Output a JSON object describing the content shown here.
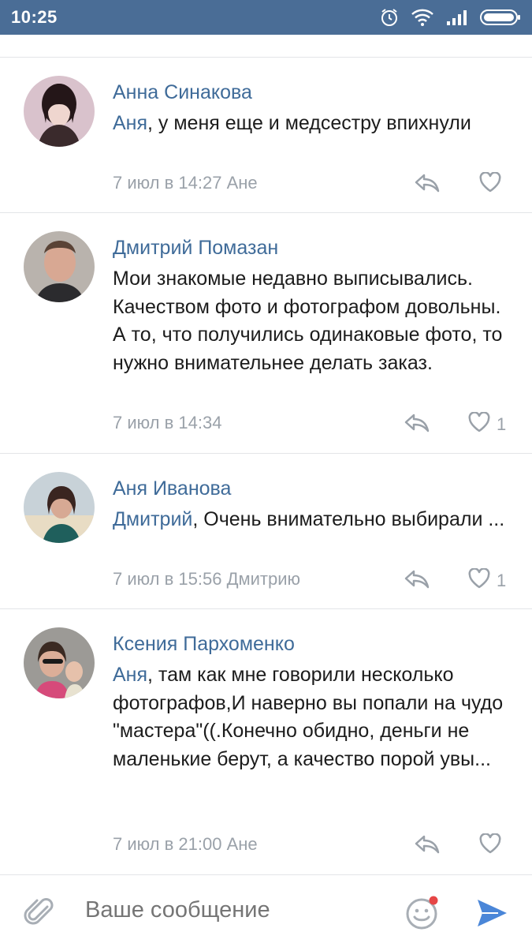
{
  "status_bar": {
    "time": "10:25",
    "icons": [
      "alarm-icon",
      "wifi-icon",
      "signal-icon",
      "battery-icon"
    ]
  },
  "comments": [
    {
      "author": "Анна Синакова",
      "mention": "Аня",
      "text": ", у меня еще и медсестру впихнули",
      "meta": "7 июл в 14:27 Ане",
      "likes": ""
    },
    {
      "author": "Дмитрий Помазан",
      "mention": "",
      "text": "Мои знакомые недавно выписывались. Качеством фото и фотографом довольны. А то, что получились одинаковые фото, то нужно внимательнее делать заказ.",
      "meta": "7 июл в 14:34",
      "likes": "1"
    },
    {
      "author": "Аня Иванова",
      "mention": "Дмитрий",
      "text": ", Очень внимательно выбирали ...",
      "meta": "7 июл в 15:56 Дмитрию",
      "likes": "1"
    },
    {
      "author": "Ксения Пархоменко",
      "mention": "Аня",
      "text": ", там как мне говорили несколько фотографов,И наверно вы попали на чудо \"мастера\"((.Конечно обидно, деньги не маленькие берут, а качество порой увы...",
      "meta": "7 июл в 21:00 Ане",
      "likes": ""
    }
  ],
  "composer": {
    "placeholder": "Ваше сообщение"
  },
  "colors": {
    "status_bar": "#4a6d96",
    "link": "#3f6b99",
    "meta": "#9aa1a9",
    "send": "#4a86d8",
    "notification_dot": "#e64646"
  }
}
